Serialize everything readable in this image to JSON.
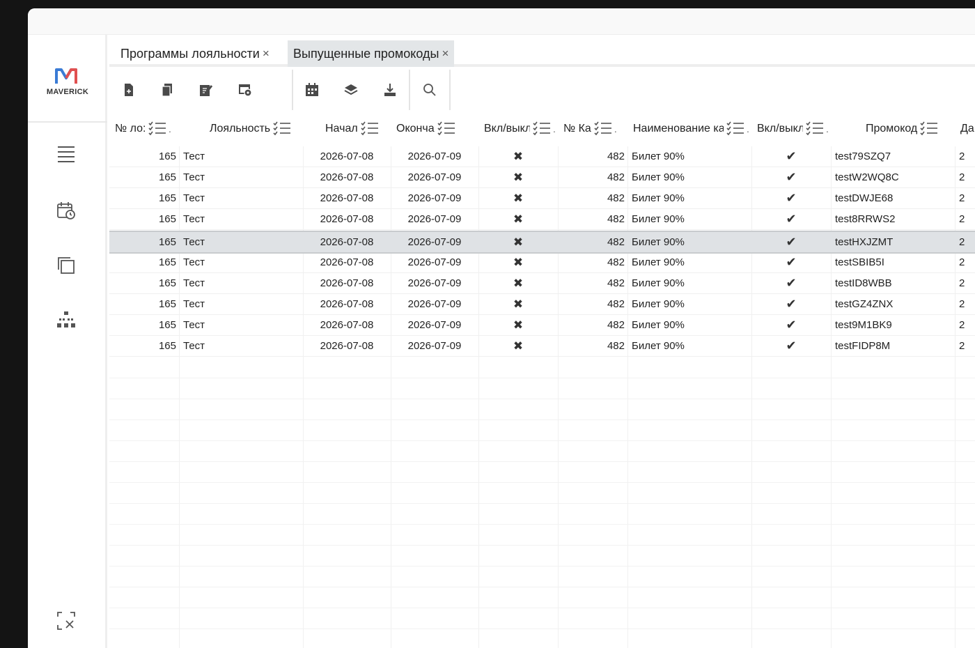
{
  "app": {
    "brand": "MAVERICK",
    "colors": {
      "accent": "#e05050",
      "accent2": "#3a7bd5",
      "selected_row": "#dfe2e5",
      "icon": "#4a4a4a"
    }
  },
  "sidebar": {
    "items": [
      {
        "icon": "menu-icon"
      },
      {
        "icon": "calendar-clock-icon"
      },
      {
        "icon": "copy-windows-icon"
      },
      {
        "icon": "hierarchy-icon"
      },
      {
        "icon": "fullscreen-exit-icon"
      }
    ]
  },
  "tabs": [
    {
      "label": "Программы лояльности",
      "close": "×",
      "active": false
    },
    {
      "label": "Выпущенные промокоды",
      "close": "×",
      "active": true
    }
  ],
  "toolbar": {
    "buttons": [
      "new-doc-icon",
      "copy-doc-icon",
      "edit-doc-icon",
      "settings-doc-icon",
      "calendar-grid-icon",
      "layers-icon",
      "export-icon",
      "search-icon"
    ]
  },
  "table": {
    "columns": [
      {
        "label": "№ ло:",
        "dot": "."
      },
      {
        "label": "Лояльность",
        "dot": ""
      },
      {
        "label": "Начал",
        "dot": ""
      },
      {
        "label": "Оконча",
        "dot": ""
      },
      {
        "label": "Вкл/выкл",
        "dot": "."
      },
      {
        "label": "№ Ка",
        "dot": "."
      },
      {
        "label": "Наименование ка",
        "dot": "."
      },
      {
        "label": "Вкл/выкл",
        "dot": "."
      },
      {
        "label": "Промокод",
        "dot": ""
      },
      {
        "label": "Да",
        "dot": ""
      }
    ],
    "rows": [
      {
        "num": "165",
        "loyalty": "Тест",
        "start": "2026-07-08",
        "end": "2026-07-09",
        "enabled": "✖",
        "cat_num": "482",
        "cat_name": "Билет 90%",
        "cat_enabled": "✔",
        "promo": "test79SZQ7",
        "date": "2"
      },
      {
        "num": "165",
        "loyalty": "Тест",
        "start": "2026-07-08",
        "end": "2026-07-09",
        "enabled": "✖",
        "cat_num": "482",
        "cat_name": "Билет 90%",
        "cat_enabled": "✔",
        "promo": "testW2WQ8C",
        "date": "2"
      },
      {
        "num": "165",
        "loyalty": "Тест",
        "start": "2026-07-08",
        "end": "2026-07-09",
        "enabled": "✖",
        "cat_num": "482",
        "cat_name": "Билет 90%",
        "cat_enabled": "✔",
        "promo": "testDWJE68",
        "date": "2"
      },
      {
        "num": "165",
        "loyalty": "Тест",
        "start": "2026-07-08",
        "end": "2026-07-09",
        "enabled": "✖",
        "cat_num": "482",
        "cat_name": "Билет 90%",
        "cat_enabled": "✔",
        "promo": "test8RRWS2",
        "date": "2"
      },
      {
        "num": "165",
        "loyalty": "Тест",
        "start": "2026-07-08",
        "end": "2026-07-09",
        "enabled": "✖",
        "cat_num": "482",
        "cat_name": "Билет 90%",
        "cat_enabled": "✔",
        "promo": "testHXJZMT",
        "date": "2",
        "selected": true
      },
      {
        "num": "165",
        "loyalty": "Тест",
        "start": "2026-07-08",
        "end": "2026-07-09",
        "enabled": "✖",
        "cat_num": "482",
        "cat_name": "Билет 90%",
        "cat_enabled": "✔",
        "promo": "testSBIB5I",
        "date": "2"
      },
      {
        "num": "165",
        "loyalty": "Тест",
        "start": "2026-07-08",
        "end": "2026-07-09",
        "enabled": "✖",
        "cat_num": "482",
        "cat_name": "Билет 90%",
        "cat_enabled": "✔",
        "promo": "testID8WBB",
        "date": "2"
      },
      {
        "num": "165",
        "loyalty": "Тест",
        "start": "2026-07-08",
        "end": "2026-07-09",
        "enabled": "✖",
        "cat_num": "482",
        "cat_name": "Билет 90%",
        "cat_enabled": "✔",
        "promo": "testGZ4ZNX",
        "date": "2"
      },
      {
        "num": "165",
        "loyalty": "Тест",
        "start": "2026-07-08",
        "end": "2026-07-09",
        "enabled": "✖",
        "cat_num": "482",
        "cat_name": "Билет 90%",
        "cat_enabled": "✔",
        "promo": "test9M1BK9",
        "date": "2"
      },
      {
        "num": "165",
        "loyalty": "Тест",
        "start": "2026-07-08",
        "end": "2026-07-09",
        "enabled": "✖",
        "cat_num": "482",
        "cat_name": "Билет 90%",
        "cat_enabled": "✔",
        "promo": "testFIDP8M",
        "date": "2"
      }
    ]
  }
}
